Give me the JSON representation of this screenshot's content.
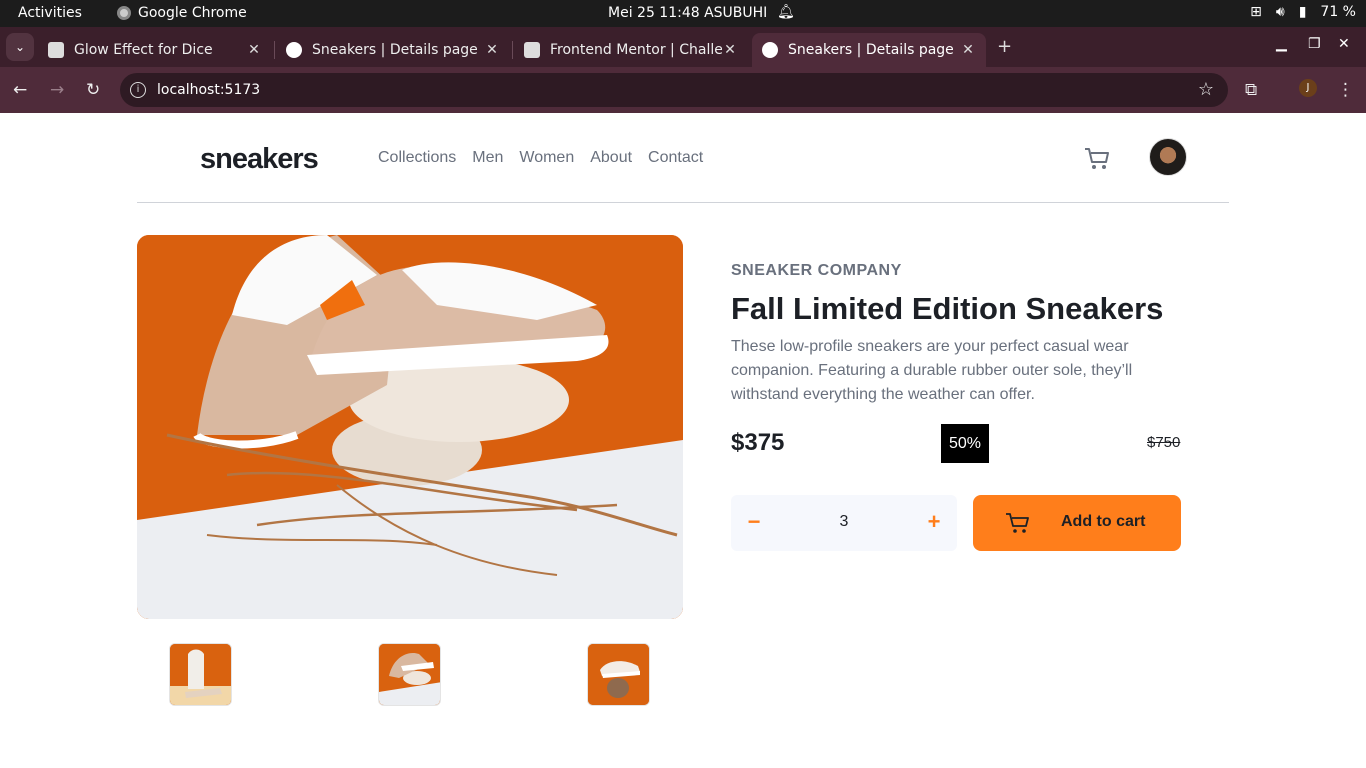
{
  "system_bar": {
    "activities": "Activities",
    "app_name": "Google Chrome",
    "clock": "Mei 25  11:48 ASUBUHI",
    "battery": "71 %"
  },
  "browser": {
    "tabs": [
      {
        "title": "Glow Effect for Dice",
        "active": false
      },
      {
        "title": "Sneakers | Details page",
        "active": false
      },
      {
        "title": "Frontend Mentor | Challe",
        "active": false
      },
      {
        "title": "Sneakers | Details page",
        "active": true
      }
    ],
    "url": "localhost:5173",
    "profile_initial": "J"
  },
  "site": {
    "logo": "sneakers",
    "nav": [
      "Collections",
      "Men",
      "Women",
      "About",
      "Contact"
    ]
  },
  "product": {
    "company": "SNEAKER COMPANY",
    "title": "Fall Limited Edition Sneakers",
    "description": "These low-profile sneakers are your perfect casual wear companion. Featuring a durable rubber outer sole, they’ll withstand everything the weather can offer.",
    "price": "$375",
    "discount": "50%",
    "original_price": "$750",
    "quantity": "3",
    "add_to_cart": "Add to cart",
    "minus": "−",
    "plus": "+"
  },
  "colors": {
    "accent": "#ff7e1b",
    "text_dark": "#1d2026",
    "text_muted": "#69707d",
    "image_orange": "#d95f0e"
  }
}
